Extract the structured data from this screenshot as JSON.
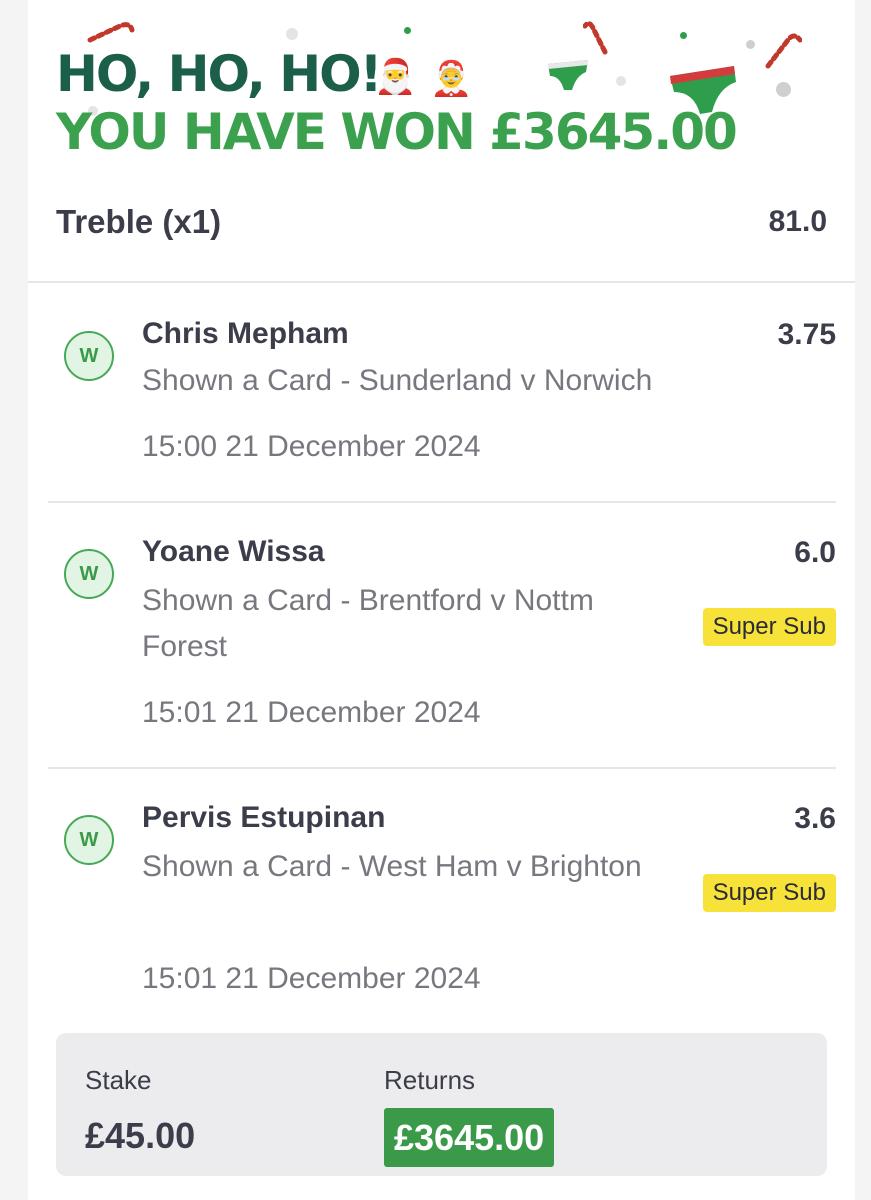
{
  "banner": {
    "line1": "HO, HO, HO!",
    "line2": "YOU HAVE WON £3645.00",
    "emoji_santa": "🎅",
    "emoji_mrs_claus": "🤶",
    "colors": {
      "line1": "#1b5e4a",
      "line2": "#3ca14e"
    }
  },
  "bet": {
    "type": "Treble (x1)",
    "odds": "81.0"
  },
  "selections": [
    {
      "status": "W",
      "name": "Chris Mepham",
      "market": "Shown a Card - Sunderland v Norwich",
      "datetime": "15:00 21 December 2024",
      "odds": "3.75",
      "tag": ""
    },
    {
      "status": "W",
      "name": "Yoane Wissa",
      "market": "Shown a Card - Brentford v Nottm Forest",
      "datetime": "15:01 21 December 2024",
      "odds": "6.0",
      "tag": "Super Sub"
    },
    {
      "status": "W",
      "name": "Pervis Estupinan",
      "market": "Shown a Card - West Ham v Brighton",
      "datetime": "15:01 21 December 2024",
      "odds": "3.6",
      "tag": "Super Sub"
    }
  ],
  "summary": {
    "stake_label": "Stake",
    "stake_value": "£45.00",
    "returns_label": "Returns",
    "returns_value": "£3645.00",
    "returns_color": "#3a9a4a"
  },
  "icons": [
    "candy-cane-icon",
    "underpants-icon",
    "snowflake-dot-icon"
  ]
}
